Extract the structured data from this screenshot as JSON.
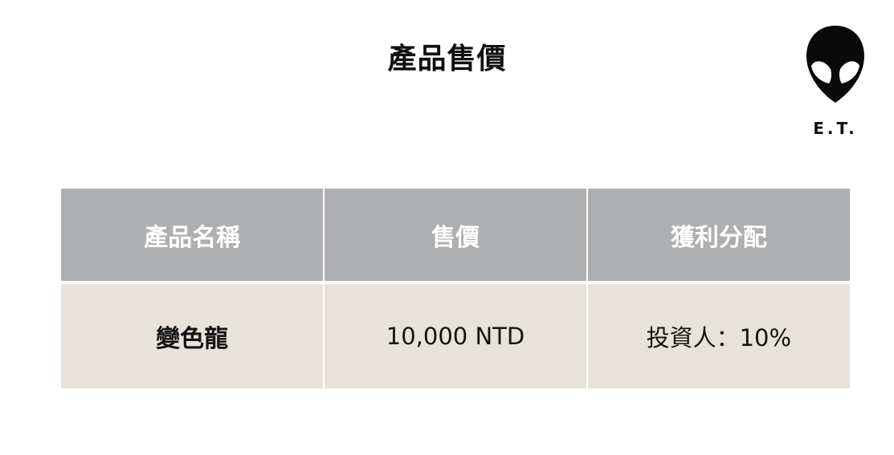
{
  "title": "產品售價",
  "logo": {
    "text": "E.T.",
    "icon": "alien-head-icon"
  },
  "table": {
    "headers": [
      "產品名稱",
      "售價",
      "獲利分配"
    ],
    "rows": [
      {
        "name": "變色龍",
        "price": "10,000 NTD",
        "profit_share": "投資人：10%"
      }
    ]
  },
  "colors": {
    "header_bg": "#aeafb1",
    "header_text": "#ffffff",
    "row_bg": "#e8e2dc",
    "text": "#111111"
  }
}
